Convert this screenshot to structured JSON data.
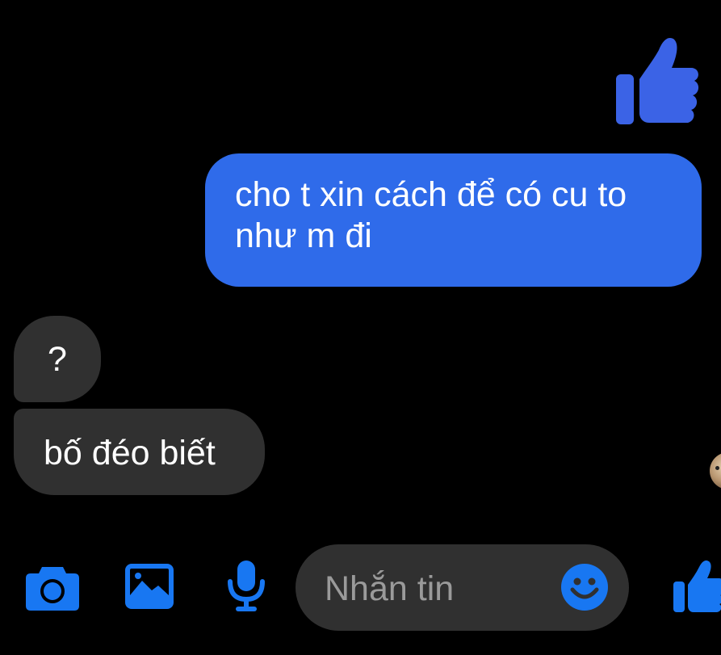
{
  "conversation": {
    "messages": [
      {
        "direction": "outgoing",
        "type": "sticker",
        "icon": "thumbs-up-icon"
      },
      {
        "direction": "outgoing",
        "type": "text",
        "text": "cho t xin cách để có cu to như m đi"
      },
      {
        "direction": "incoming",
        "type": "text",
        "text": "?"
      },
      {
        "direction": "incoming",
        "type": "text",
        "text": "bố đéo biết"
      }
    ]
  },
  "composer": {
    "placeholder": "Nhắn tin",
    "tools": [
      "camera-icon",
      "gallery-icon",
      "microphone-icon"
    ],
    "emoji_icon": "emoji-icon",
    "send_icon": "thumbs-up-icon"
  },
  "colors": {
    "background": "#000000",
    "outgoing_bubble": "#2f6bea",
    "incoming_bubble": "#303030",
    "accent": "#1877f2",
    "sticker_like": "#3b63e6"
  }
}
